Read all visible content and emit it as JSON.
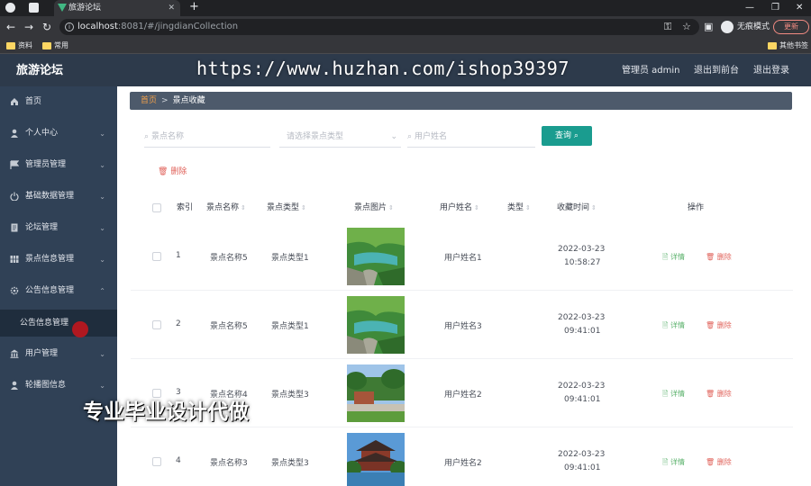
{
  "browser": {
    "tab_title": "旅游论坛",
    "url_host": "localhost",
    "url_path": ":8081/#/jingdianCollection",
    "incognito_label": "无痕模式",
    "update_label": "更新",
    "bookmarks": [
      "资料",
      "常用"
    ],
    "bookmarks_right": "其他书签"
  },
  "header": {
    "logo": "旅游论坛",
    "user": "管理员 admin",
    "back_front": "退出到前台",
    "logout": "退出登录"
  },
  "sidebar": {
    "items": [
      {
        "label": "首页",
        "icon": "home-icon"
      },
      {
        "label": "个人中心",
        "icon": "user-icon"
      },
      {
        "label": "管理员管理",
        "icon": "flag-icon"
      },
      {
        "label": "基础数据管理",
        "icon": "power-icon"
      },
      {
        "label": "论坛管理",
        "icon": "document-icon"
      },
      {
        "label": "景点信息管理",
        "icon": "grid-icon"
      },
      {
        "label": "公告信息管理",
        "icon": "gear-icon"
      },
      {
        "label": "用户管理",
        "icon": "bank-icon"
      },
      {
        "label": "轮播图信息",
        "icon": "user-icon"
      }
    ],
    "submenu_label": "公告信息管理"
  },
  "breadcrumb": {
    "home": "首页",
    "current": "景点收藏"
  },
  "search": {
    "name_placeholder": "景点名称",
    "type_placeholder": "请选择景点类型",
    "user_placeholder": "用户姓名",
    "query_label": "查询"
  },
  "toolbar": {
    "delete_label": "删除"
  },
  "table": {
    "headers": [
      "索引",
      "景点名称",
      "景点类型",
      "景点图片",
      "用户姓名",
      "类型",
      "收藏时间",
      "操作"
    ],
    "rows": [
      {
        "index": "1",
        "name": "景点名称5",
        "type": "景点类型1",
        "user": "用户姓名1",
        "date": "2022-03-23",
        "time": "10:58:27"
      },
      {
        "index": "2",
        "name": "景点名称5",
        "type": "景点类型1",
        "user": "用户姓名3",
        "date": "2022-03-23",
        "time": "09:41:01"
      },
      {
        "index": "3",
        "name": "景点名称4",
        "type": "景点类型3",
        "user": "用户姓名2",
        "date": "2022-03-23",
        "time": "09:41:01"
      },
      {
        "index": "4",
        "name": "景点名称3",
        "type": "景点类型3",
        "user": "用户姓名2",
        "date": "2022-03-23",
        "time": "09:41:01"
      }
    ],
    "detail_label": "详情",
    "remove_label": "删除"
  },
  "watermark": "https://www.huzhan.com/ishop39397",
  "overlay_text": "专业毕业设计代做",
  "colors": {
    "sidebar": "#304156",
    "header": "#2d3a4b",
    "primary": "#1a9c8f",
    "danger": "#e0625a",
    "success": "#58b06a"
  }
}
